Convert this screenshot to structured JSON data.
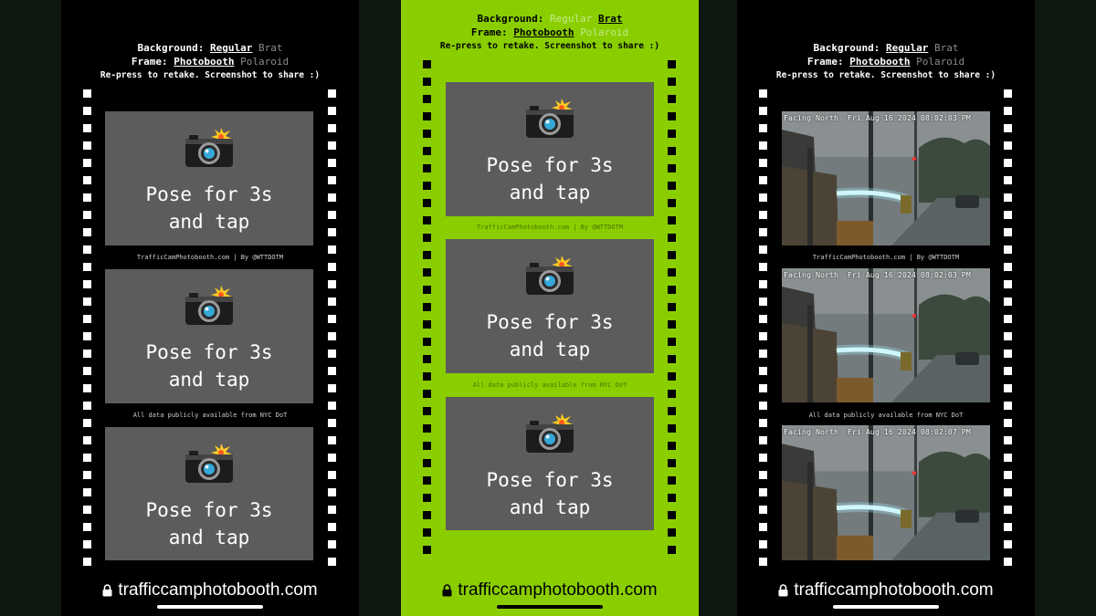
{
  "controls": {
    "background_label": "Background:",
    "background_regular": "Regular",
    "background_brat": "Brat",
    "frame_label": "Frame:",
    "frame_photobooth": "Photobooth",
    "frame_polaroid": "Polaroid",
    "tip": "Re-press to retake. Screenshot to share :)"
  },
  "tile": {
    "pose_line1": "Pose for 3s",
    "pose_line2": "and tap",
    "icon": "camera-with-flash-icon"
  },
  "captions": {
    "credit": "TrafficCamPhotobooth.com | By @WTTDOTM",
    "data_source": "All data publicly available from NYC DoT"
  },
  "feed_timestamps": [
    "Facing North  Fri Aug 16 2024 08:02:03 PM",
    "Facing North  Fri Aug 16 2024 08:02:03 PM",
    "Facing North  Fri Aug 16 2024 08:02:07 PM"
  ],
  "browser": {
    "url": "trafficcamphotobooth.com",
    "lock_icon": "lock-icon"
  },
  "colors": {
    "brat_green": "#8ace00",
    "tile_gray": "#5c5c5c",
    "backdrop": "#0e1710"
  }
}
